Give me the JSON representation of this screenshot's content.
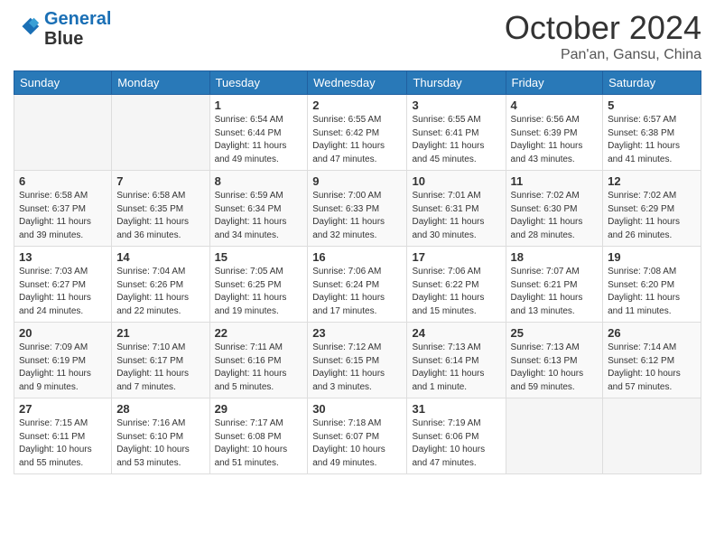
{
  "logo": {
    "line1": "General",
    "line2": "Blue"
  },
  "title": "October 2024",
  "location": "Pan'an, Gansu, China",
  "weekdays": [
    "Sunday",
    "Monday",
    "Tuesday",
    "Wednesday",
    "Thursday",
    "Friday",
    "Saturday"
  ],
  "rows": [
    [
      {
        "day": "",
        "info": ""
      },
      {
        "day": "",
        "info": ""
      },
      {
        "day": "1",
        "info": "Sunrise: 6:54 AM\nSunset: 6:44 PM\nDaylight: 11 hours and 49 minutes."
      },
      {
        "day": "2",
        "info": "Sunrise: 6:55 AM\nSunset: 6:42 PM\nDaylight: 11 hours and 47 minutes."
      },
      {
        "day": "3",
        "info": "Sunrise: 6:55 AM\nSunset: 6:41 PM\nDaylight: 11 hours and 45 minutes."
      },
      {
        "day": "4",
        "info": "Sunrise: 6:56 AM\nSunset: 6:39 PM\nDaylight: 11 hours and 43 minutes."
      },
      {
        "day": "5",
        "info": "Sunrise: 6:57 AM\nSunset: 6:38 PM\nDaylight: 11 hours and 41 minutes."
      }
    ],
    [
      {
        "day": "6",
        "info": "Sunrise: 6:58 AM\nSunset: 6:37 PM\nDaylight: 11 hours and 39 minutes."
      },
      {
        "day": "7",
        "info": "Sunrise: 6:58 AM\nSunset: 6:35 PM\nDaylight: 11 hours and 36 minutes."
      },
      {
        "day": "8",
        "info": "Sunrise: 6:59 AM\nSunset: 6:34 PM\nDaylight: 11 hours and 34 minutes."
      },
      {
        "day": "9",
        "info": "Sunrise: 7:00 AM\nSunset: 6:33 PM\nDaylight: 11 hours and 32 minutes."
      },
      {
        "day": "10",
        "info": "Sunrise: 7:01 AM\nSunset: 6:31 PM\nDaylight: 11 hours and 30 minutes."
      },
      {
        "day": "11",
        "info": "Sunrise: 7:02 AM\nSunset: 6:30 PM\nDaylight: 11 hours and 28 minutes."
      },
      {
        "day": "12",
        "info": "Sunrise: 7:02 AM\nSunset: 6:29 PM\nDaylight: 11 hours and 26 minutes."
      }
    ],
    [
      {
        "day": "13",
        "info": "Sunrise: 7:03 AM\nSunset: 6:27 PM\nDaylight: 11 hours and 24 minutes."
      },
      {
        "day": "14",
        "info": "Sunrise: 7:04 AM\nSunset: 6:26 PM\nDaylight: 11 hours and 22 minutes."
      },
      {
        "day": "15",
        "info": "Sunrise: 7:05 AM\nSunset: 6:25 PM\nDaylight: 11 hours and 19 minutes."
      },
      {
        "day": "16",
        "info": "Sunrise: 7:06 AM\nSunset: 6:24 PM\nDaylight: 11 hours and 17 minutes."
      },
      {
        "day": "17",
        "info": "Sunrise: 7:06 AM\nSunset: 6:22 PM\nDaylight: 11 hours and 15 minutes."
      },
      {
        "day": "18",
        "info": "Sunrise: 7:07 AM\nSunset: 6:21 PM\nDaylight: 11 hours and 13 minutes."
      },
      {
        "day": "19",
        "info": "Sunrise: 7:08 AM\nSunset: 6:20 PM\nDaylight: 11 hours and 11 minutes."
      }
    ],
    [
      {
        "day": "20",
        "info": "Sunrise: 7:09 AM\nSunset: 6:19 PM\nDaylight: 11 hours and 9 minutes."
      },
      {
        "day": "21",
        "info": "Sunrise: 7:10 AM\nSunset: 6:17 PM\nDaylight: 11 hours and 7 minutes."
      },
      {
        "day": "22",
        "info": "Sunrise: 7:11 AM\nSunset: 6:16 PM\nDaylight: 11 hours and 5 minutes."
      },
      {
        "day": "23",
        "info": "Sunrise: 7:12 AM\nSunset: 6:15 PM\nDaylight: 11 hours and 3 minutes."
      },
      {
        "day": "24",
        "info": "Sunrise: 7:13 AM\nSunset: 6:14 PM\nDaylight: 11 hours and 1 minute."
      },
      {
        "day": "25",
        "info": "Sunrise: 7:13 AM\nSunset: 6:13 PM\nDaylight: 10 hours and 59 minutes."
      },
      {
        "day": "26",
        "info": "Sunrise: 7:14 AM\nSunset: 6:12 PM\nDaylight: 10 hours and 57 minutes."
      }
    ],
    [
      {
        "day": "27",
        "info": "Sunrise: 7:15 AM\nSunset: 6:11 PM\nDaylight: 10 hours and 55 minutes."
      },
      {
        "day": "28",
        "info": "Sunrise: 7:16 AM\nSunset: 6:10 PM\nDaylight: 10 hours and 53 minutes."
      },
      {
        "day": "29",
        "info": "Sunrise: 7:17 AM\nSunset: 6:08 PM\nDaylight: 10 hours and 51 minutes."
      },
      {
        "day": "30",
        "info": "Sunrise: 7:18 AM\nSunset: 6:07 PM\nDaylight: 10 hours and 49 minutes."
      },
      {
        "day": "31",
        "info": "Sunrise: 7:19 AM\nSunset: 6:06 PM\nDaylight: 10 hours and 47 minutes."
      },
      {
        "day": "",
        "info": ""
      },
      {
        "day": "",
        "info": ""
      }
    ]
  ]
}
